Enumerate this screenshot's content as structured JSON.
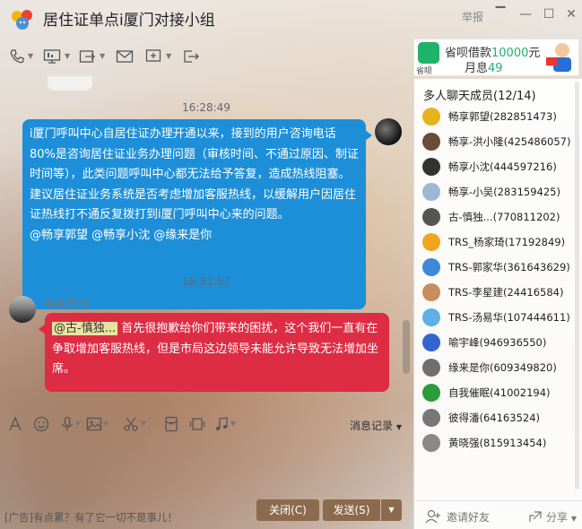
{
  "window": {
    "title": "居住证单点i厦门对接小组",
    "report_label": "举报"
  },
  "ad_banner": {
    "line1_prefix": "省呗借款",
    "line1_amount": "10000",
    "line1_suffix": "元",
    "line2_prefix": "月息",
    "line2_rate": "49",
    "logo_text": "省呗"
  },
  "chat": {
    "messages": [
      {
        "time": "16:28:49",
        "sender": "self",
        "text": "i厦门呼叫中心自居住证办理开通以来，接到的用户咨询电话80%是咨询居住证业务办理问题（审核时间、不通过原因、制证时间等），此类问题呼叫中心都无法给予答复，造成热线阻塞。建议居住证业务系统是否考虑增加客服热线，以缓解用户因居住证热线打不通反复拨打到i厦门呼叫中心来的问题。",
        "mentions": "@畅享郭望 @畅享小沈 @缘来是你"
      },
      {
        "time": "16:31:57",
        "sender": "缘来是你",
        "mention": "@古-慎独...",
        "text": "首先很抱歉给你们带来的困扰，这个我们一直有在争取增加客服热线，但是市局这边领导未能允许导致无法增加坐席。"
      }
    ]
  },
  "input": {
    "history_label": "消息记录"
  },
  "footer": {
    "ad_text": "[广告]有点累？有了它一切不是事儿！",
    "close_label": "关闭(C)",
    "send_label": "发送(S)"
  },
  "members": {
    "header": "多人聊天成员(12/14)",
    "list": [
      {
        "name": "畅享郭望(282851473)",
        "color": "#e7b21a"
      },
      {
        "name": "畅享-洪小隆(425486057)",
        "color": "#6b4a3a"
      },
      {
        "name": "畅享小沈(444597216)",
        "color": "#333333"
      },
      {
        "name": "畅享-小吴(283159425)",
        "color": "#9bb7d4"
      },
      {
        "name": "古-慎独...(770811202)",
        "color": "#555555"
      },
      {
        "name": "TRS_杨家琦(17192849)",
        "color": "#f2a51c"
      },
      {
        "name": "TRS-郭家华(361643629)",
        "color": "#3b8ad9"
      },
      {
        "name": "TRS-李星建(24416584)",
        "color": "#c98c5a"
      },
      {
        "name": "TRS-汤易华(107444611)",
        "color": "#5db0e8"
      },
      {
        "name": "喻宇峰(946936550)",
        "color": "#3366cc"
      },
      {
        "name": "缘来是你(609349820)",
        "color": "#6f6f6f"
      },
      {
        "name": "自我催眠(41002194)",
        "color": "#2a9d3a"
      },
      {
        "name": "彼得潘(64163524)",
        "color": "#777777"
      },
      {
        "name": "黄晓强(815913454)",
        "color": "#888888"
      }
    ],
    "invite_label": "邀请好友",
    "share_label": "分享"
  },
  "colors": {
    "self_bubble": "#1d8fd9",
    "other_bubble": "#dd2c44",
    "button": "#8c6a4d",
    "ad_accent": "#1fb26b"
  }
}
